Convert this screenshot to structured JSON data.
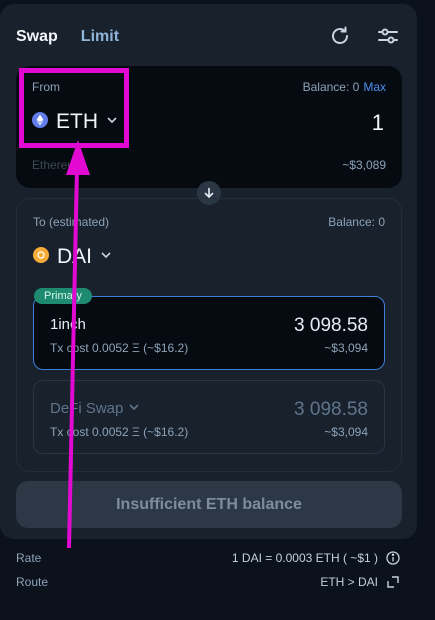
{
  "tabs": [
    "Swap",
    "Limit"
  ],
  "from": {
    "label": "From",
    "balance_label": "Balance: 0",
    "max_label": "Max",
    "token_symbol": "ETH",
    "amount": "1",
    "token_full_name": "Ethereum",
    "usd_value": "~$3,089"
  },
  "to": {
    "label": "To (estimated)",
    "balance_label": "Balance: 0",
    "token_symbol": "DAI"
  },
  "quotes": [
    {
      "badge": "Primary",
      "name": "1inch",
      "amount": "3 098.58",
      "tx_cost": "Tx cost  0.0052 Ξ  (~$16.2)",
      "usd": "~$3,094"
    },
    {
      "name": "DeFi Swap",
      "amount": "3 098.58",
      "tx_cost": "Tx cost  0.0052 Ξ  (~$16.2)",
      "usd": "~$3,094"
    }
  ],
  "action_button": "Insufficient ETH balance",
  "footer": {
    "rate_label": "Rate",
    "rate_value": "1 DAI = 0.0003 ETH ( ~$1 )",
    "route_label": "Route",
    "route_value": "ETH > DAI"
  },
  "colors": {
    "accent": "#4b8ff0",
    "annotation": "#e20ad2",
    "badge": "#1e8a70"
  }
}
